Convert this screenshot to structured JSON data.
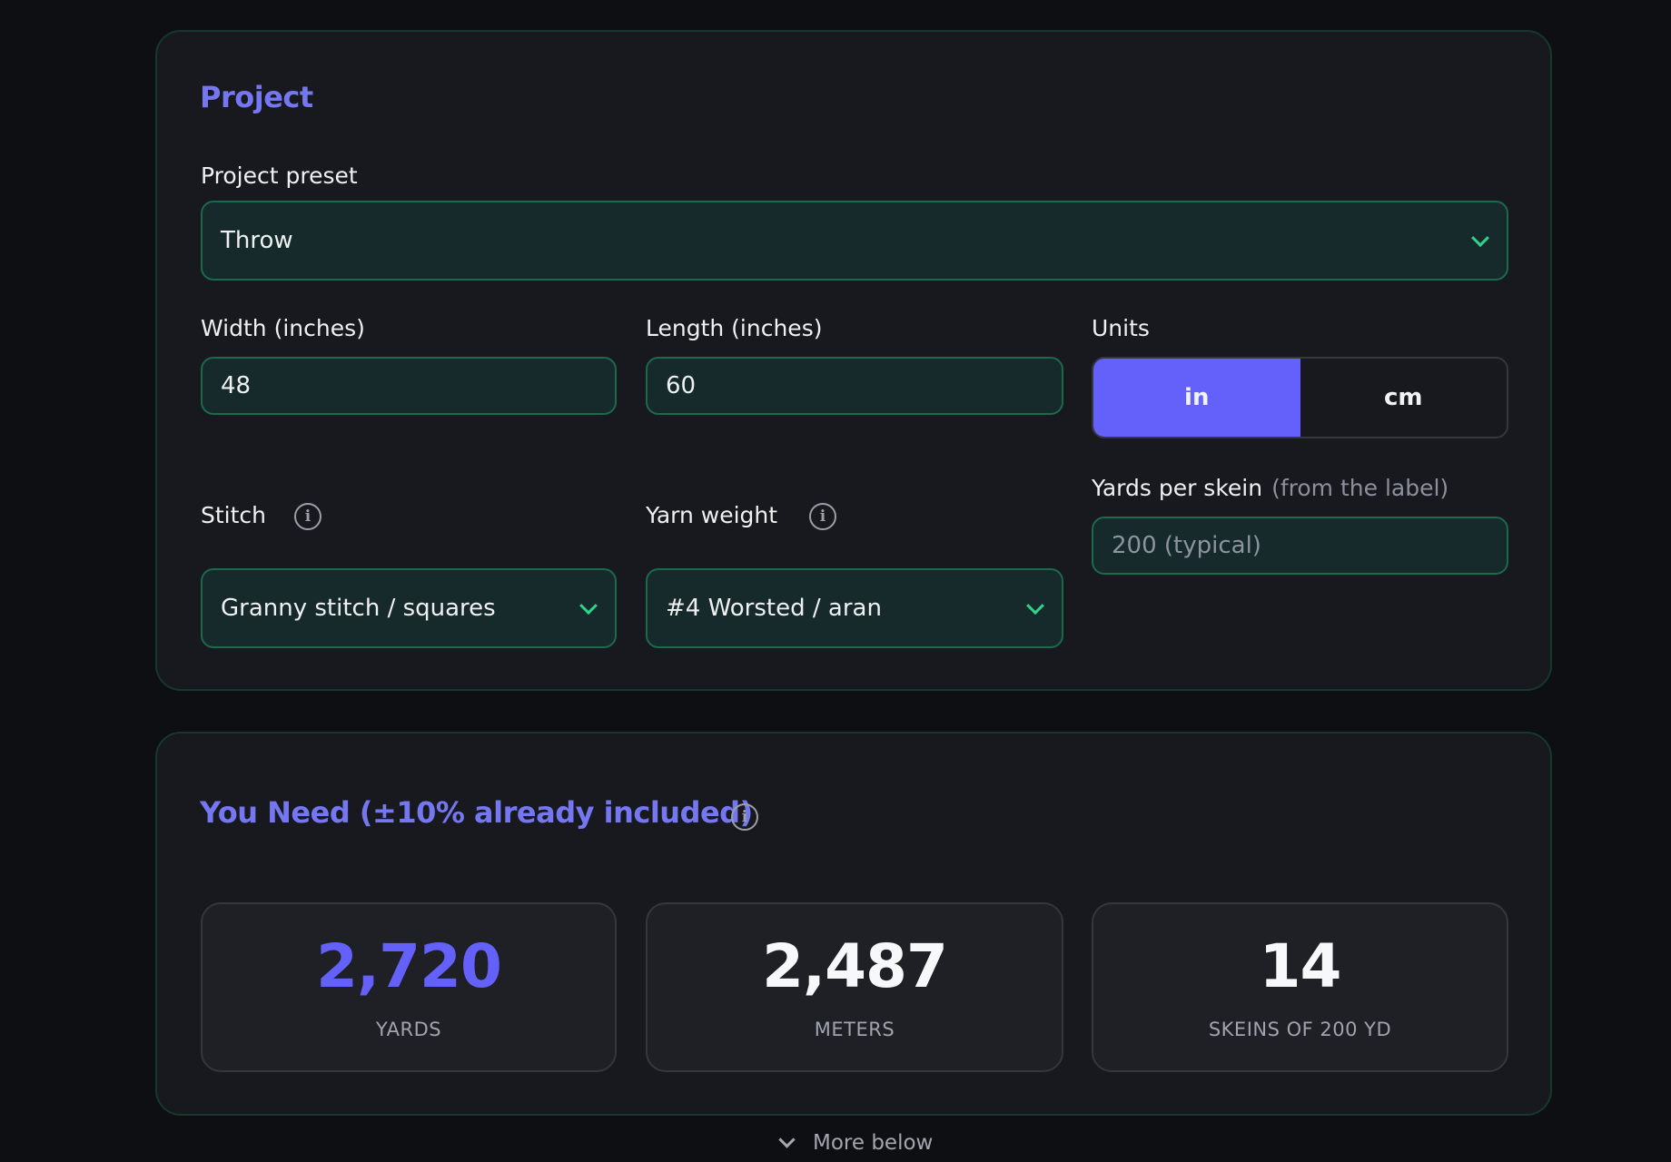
{
  "project": {
    "title": "Project",
    "preset": {
      "label": "Project preset",
      "value": "Throw"
    },
    "width": {
      "label": "Width (inches)",
      "value": "48"
    },
    "length": {
      "label": "Length (inches)",
      "value": "60"
    },
    "units": {
      "label": "Units",
      "options": [
        "in",
        "cm"
      ],
      "selected": "in"
    },
    "stitch": {
      "label": "Stitch",
      "value": "Granny stitch / squares"
    },
    "yarn_weight": {
      "label": "Yarn weight",
      "value": "#4 Worsted / aran"
    },
    "yards_per_skein": {
      "label": "Yards per skein",
      "hint": "(from the label)",
      "placeholder": "200 (typical)"
    }
  },
  "result": {
    "title": "You Need (±10% already included)",
    "stats": [
      {
        "value": "2,720",
        "caption": "YARDS"
      },
      {
        "value": "2,487",
        "caption": "METERS"
      },
      {
        "value": "14",
        "caption": "SKEINS OF 200 YD"
      }
    ]
  },
  "footer": {
    "more_label": "More below"
  },
  "colors": {
    "accent": "#6461fb",
    "field_border": "#1b6a4b",
    "chevron": "#2ed38a"
  },
  "icons": {
    "info": "info-icon",
    "dropdown": "chevron-down-icon"
  }
}
